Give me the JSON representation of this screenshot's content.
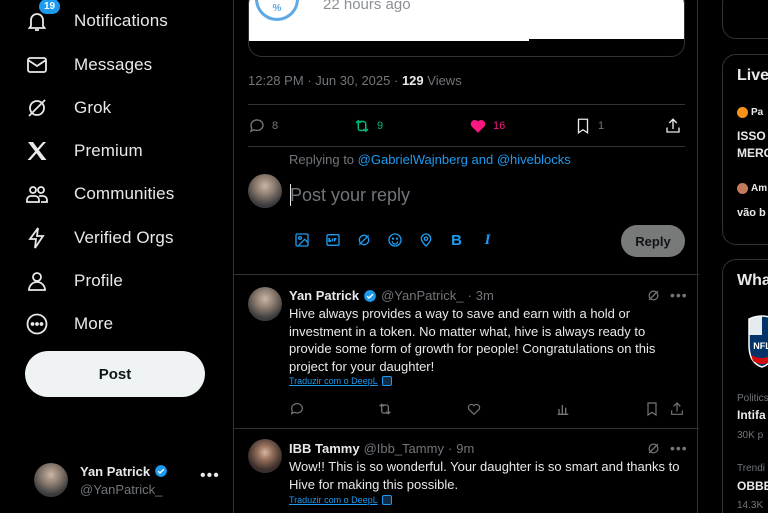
{
  "nav": {
    "items": [
      {
        "label": "Notifications",
        "icon": "bell-icon",
        "badge": "19"
      },
      {
        "label": "Messages",
        "icon": "envelope-icon"
      },
      {
        "label": "Grok",
        "icon": "grok-icon"
      },
      {
        "label": "Premium",
        "icon": "x-logo-icon"
      },
      {
        "label": "Communities",
        "icon": "people-icon"
      },
      {
        "label": "Verified Orgs",
        "icon": "lightning-icon"
      },
      {
        "label": "Profile",
        "icon": "person-icon"
      },
      {
        "label": "More",
        "icon": "more-circle-icon"
      }
    ],
    "post_label": "Post",
    "account": {
      "name": "Yan Patrick",
      "handle": "@YanPatrick_"
    }
  },
  "quoted": {
    "time_ago": "22 hours ago"
  },
  "post": {
    "timestamp": "12:28 PM · Jun 30, 2025 · ",
    "views": "129",
    "views_label": " Views",
    "stats": {
      "replies": "8",
      "reposts": "9",
      "likes": "16",
      "bookmarks": "1"
    }
  },
  "composer": {
    "replying_prefix": "Replying to ",
    "replying_to": "@GabrielWajnberg and @hiveblocks",
    "placeholder": "Post your reply",
    "reply_label": "Reply",
    "tools": [
      "image-icon",
      "gif-icon",
      "grok-icon",
      "emoji-icon",
      "location-icon",
      "bold-icon",
      "italic-icon"
    ],
    "bold_glyph": "B",
    "italic_glyph": "I"
  },
  "replies": [
    {
      "name": "Yan Patrick",
      "handle": "@YanPatrick_",
      "sep": "·",
      "time": "3m",
      "text": "Hive always provides a way to save and earn with a hold or investment in a token. No matter what, hive is always ready to provide some form of growth for people! Congratulations on this project for your daughter!",
      "translate": "Traduzir com o DeepL"
    },
    {
      "name": "IBB Tammy",
      "handle": "@Ibb_Tammy",
      "sep": "·",
      "time": "9m",
      "text": "Wow!! This is so wonderful. Your daughter is so smart and thanks to Hive for making this possible.",
      "translate": "Traduzir com o DeepL"
    }
  ],
  "right": {
    "live_title": "Live",
    "live_user1": "Pa",
    "live_text1a": "ISSO",
    "live_text1b": "MERC",
    "live_user2": "Am",
    "live_text2": "vão b",
    "whats_title": "What",
    "topic1_cat": "Politics",
    "topic1": "Intifa",
    "topic1_count": "30K p",
    "topic2_cat": "Trendi",
    "topic2": "OBBE",
    "topic2_count": "14.3K"
  },
  "colors": {
    "accent": "#1d9bf0",
    "like": "#f91880",
    "repost": "#00ba7c",
    "border": "#2f3336",
    "muted": "#71767b"
  }
}
